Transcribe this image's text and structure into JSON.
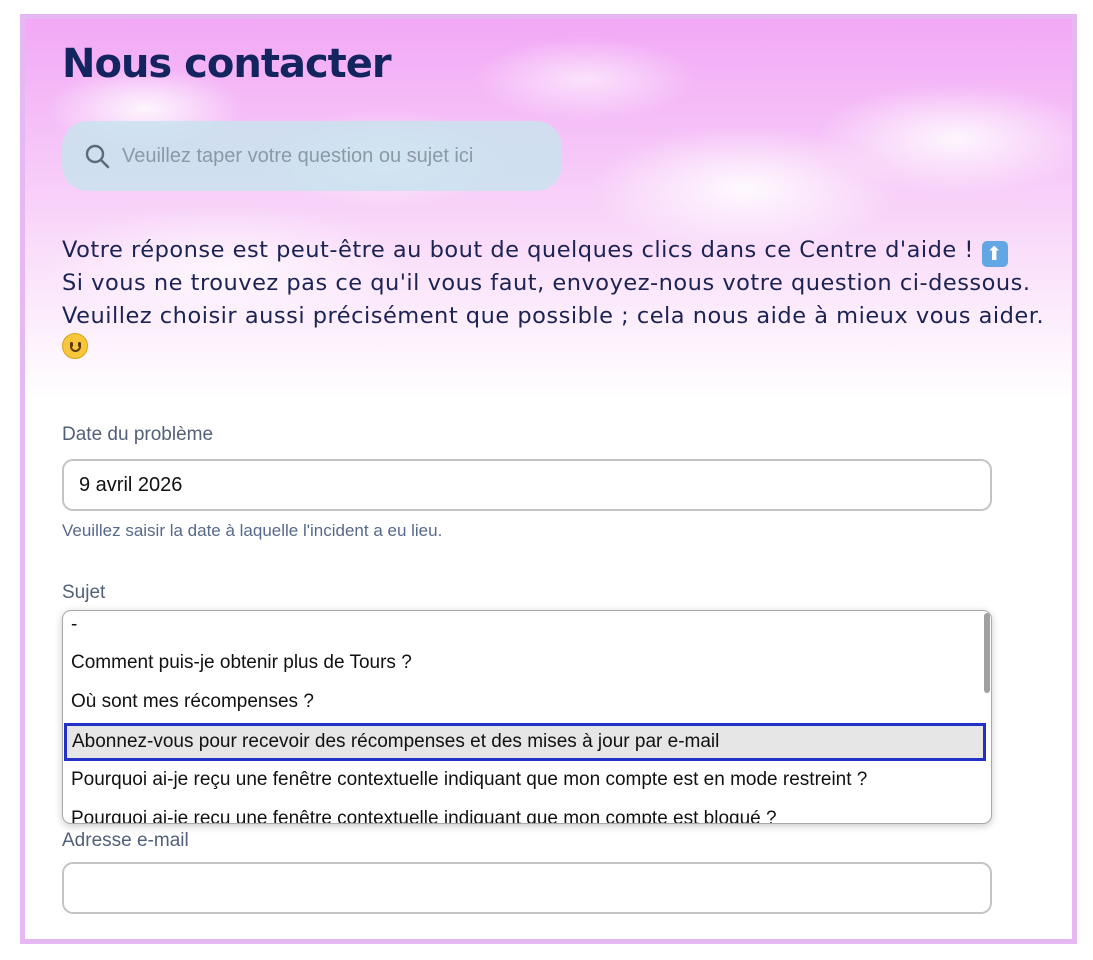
{
  "page": {
    "title": "Nous contacter"
  },
  "search": {
    "placeholder": "Veuillez taper votre question ou sujet ici",
    "icon": "search-icon"
  },
  "intro": {
    "line1": "Votre réponse est peut-être au bout de quelques clics dans ce Centre d'aide !",
    "line2": "Si vous ne trouvez pas ce qu'il vous faut, envoyez-nous votre question ci-dessous. Veuillez choisir aussi précisément que possible ; cela nous aide à mieux vous aider.",
    "emoji_up": "up-arrow-emoji",
    "emoji_smile": "smiling-face-emoji"
  },
  "date_field": {
    "label": "Date du problème",
    "value": "9 avril 2026",
    "hint": "Veuillez saisir la date à laquelle l'incident a eu lieu."
  },
  "subject_field": {
    "label": "Sujet",
    "options": [
      "-",
      "Comment puis-je obtenir plus de Tours ?",
      "Où sont mes récompenses ?",
      "Abonnez-vous pour recevoir des récompenses et des mises à jour par e-mail",
      "Pourquoi ai-je reçu une fenêtre contextuelle indiquant que mon compte est en mode restreint ?",
      "Pourquoi ai-je reçu une fenêtre contextuelle indiquant que mon compte est bloqué ?"
    ],
    "selected_index": 3
  },
  "email_field": {
    "label": "Adresse e-mail",
    "value": ""
  },
  "colors": {
    "frame_border": "#e6b8f3",
    "title": "#13245e",
    "text": "#1c2353",
    "selected_border": "#2231c6"
  }
}
